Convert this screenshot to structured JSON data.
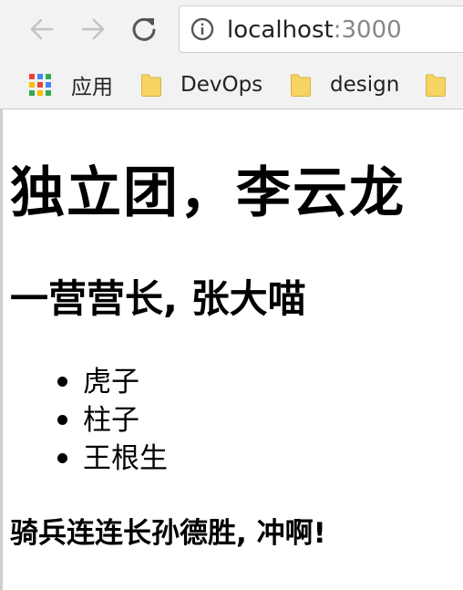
{
  "browser": {
    "url_host": "localhost",
    "url_port": ":3000",
    "icons": {
      "back": "arrow-left-icon",
      "forward": "arrow-right-icon",
      "reload": "reload-icon",
      "info": "info-icon",
      "apps": "apps-grid-icon",
      "folder": "folder-icon"
    },
    "bookmarks": [
      {
        "label": "应用"
      },
      {
        "label": "DevOps"
      },
      {
        "label": "design"
      }
    ],
    "colors": {
      "folder": "#f5d463",
      "apps_grid": [
        "#ea4335",
        "#4285f4",
        "#34a853",
        "#fbbc05",
        "#ea4335",
        "#4285f4",
        "#34a853",
        "#fbbc05",
        "#34a853"
      ]
    }
  },
  "page": {
    "heading1": "独立团，李云龙",
    "heading2": "一营营长, 张大喵",
    "list": [
      "虎子",
      "柱子",
      "王根生"
    ],
    "heading4": "骑兵连连长孙德胜, 冲啊!"
  }
}
